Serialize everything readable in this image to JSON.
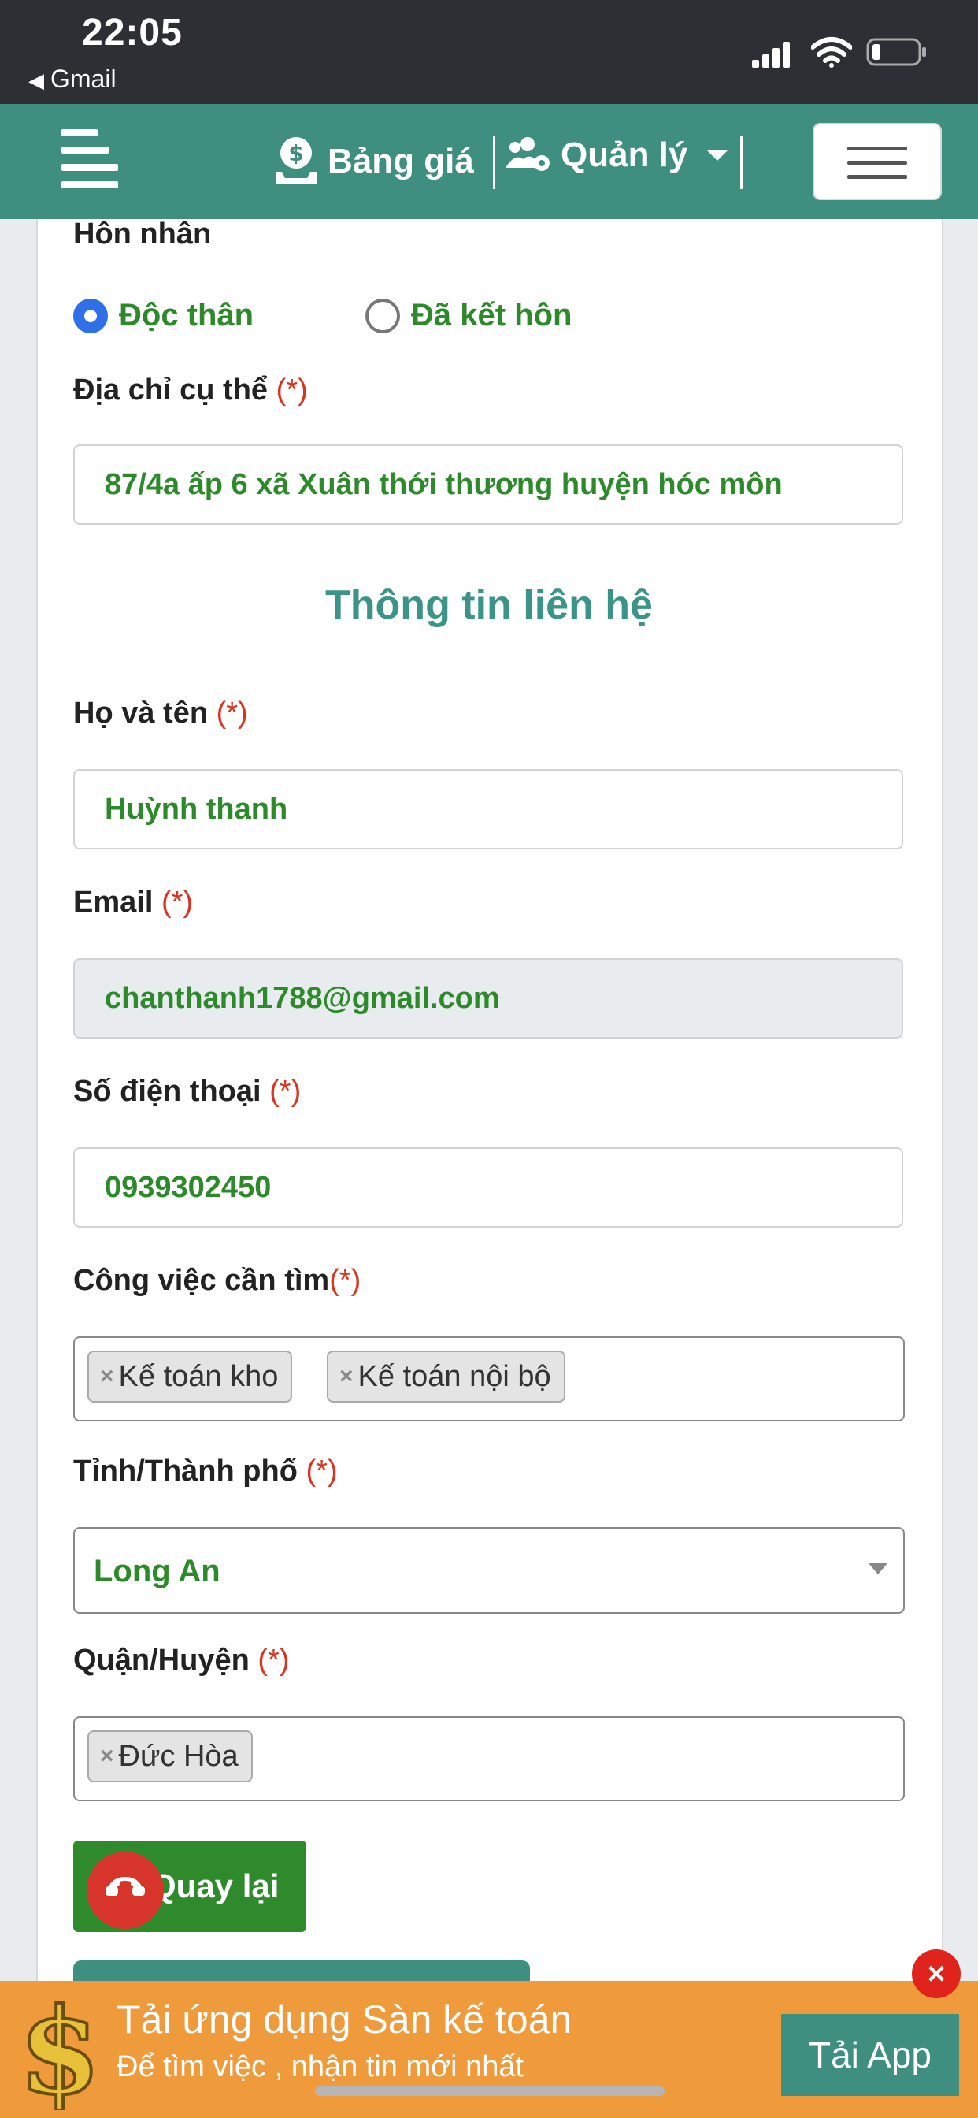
{
  "status_bar": {
    "time": "22:05",
    "back_app": "Gmail"
  },
  "navbar": {
    "price_label": "Bảng giá",
    "manage_label": "Quản lý"
  },
  "form": {
    "marital": {
      "label": "Hôn nhân",
      "options": [
        "Độc thân",
        "Đã kết hôn"
      ],
      "selected": "Độc thân"
    },
    "address": {
      "label": "Địa chỉ cụ thể",
      "required": "(*)",
      "value": "87/4a ấp 6 xã Xuân thới thương huyện hóc môn"
    },
    "contact_section_title": "Thông tin liên hệ",
    "fullname": {
      "label": "Họ và tên",
      "required": "(*)",
      "value": "Huỳnh thanh"
    },
    "email": {
      "label": "Email",
      "required": "(*)",
      "value": "chanthanh1788@gmail.com"
    },
    "phone": {
      "label": "Số điện thoại",
      "required": "(*)",
      "value": "0939302450"
    },
    "jobs": {
      "label": "Công việc cần tìm",
      "required": "(*)",
      "tags": [
        "Kế toán kho",
        "Kế toán nội bộ"
      ]
    },
    "province": {
      "label": "Tỉnh/Thành phố",
      "required": "(*)",
      "value": "Long An"
    },
    "district": {
      "label": "Quận/Huyện",
      "required": "(*)",
      "tags": [
        "Đức Hòa"
      ]
    },
    "back_button": "Quay lại"
  },
  "banner": {
    "title": "Tải ứng dụng Sàn kế toán",
    "subtitle": "Để tìm việc , nhận tin mới nhất",
    "button": "Tải App",
    "close": "×"
  },
  "icons": [
    "signal-icon",
    "wifi-icon",
    "battery-icon",
    "hamburger-icon",
    "money-bag-icon",
    "users-cog-icon",
    "caret-down-icon",
    "phone-icon",
    "dollar-icon",
    "close-icon"
  ],
  "colors": {
    "primary": "#3f8f81",
    "value_green": "#2d8a2a",
    "required_red": "#d9341f",
    "banner_orange": "#ef9a3b"
  }
}
